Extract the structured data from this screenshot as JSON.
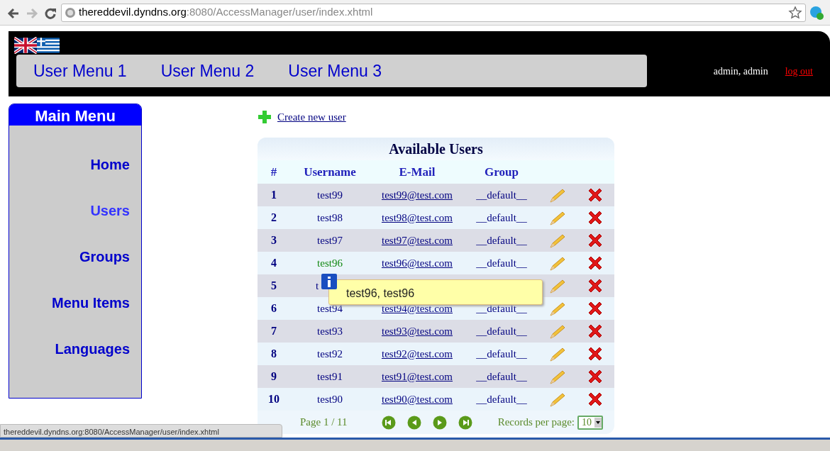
{
  "browser": {
    "url_host": "thereddevil.dyndns.org",
    "url_path": ":8080/AccessManager/user/index.xhtml"
  },
  "header": {
    "user_menu": [
      {
        "label": "User Menu 1"
      },
      {
        "label": "User Menu 2"
      },
      {
        "label": "User Menu 3"
      }
    ],
    "user": "admin, admin",
    "logout": "log out"
  },
  "main_menu": {
    "title": "Main Menu",
    "items": [
      {
        "label": "Home",
        "selected": false
      },
      {
        "label": "Users",
        "selected": true
      },
      {
        "label": "Groups",
        "selected": false
      },
      {
        "label": "Menu Items",
        "selected": false
      },
      {
        "label": "Languages",
        "selected": false
      }
    ]
  },
  "create_link": "Create new user",
  "table": {
    "title": "Available Users",
    "columns": [
      "#",
      "Username",
      "E-Mail",
      "Group"
    ],
    "rows": [
      {
        "num": "1",
        "username": "test99",
        "email": "test99@test.com",
        "group": "__default__",
        "hovered": false
      },
      {
        "num": "2",
        "username": "test98",
        "email": "test98@test.com",
        "group": "__default__",
        "hovered": false
      },
      {
        "num": "3",
        "username": "test97",
        "email": "test97@test.com",
        "group": "__default__",
        "hovered": false
      },
      {
        "num": "4",
        "username": "test96",
        "email": "test96@test.com",
        "group": "__default__",
        "hovered": true
      },
      {
        "num": "5",
        "username": "t",
        "hovered": false
      },
      {
        "num": "6",
        "username": "test94",
        "email": "test94@test.com",
        "group": "__default__",
        "hovered": false
      },
      {
        "num": "7",
        "username": "test93",
        "email": "test93@test.com",
        "group": "__default__",
        "hovered": false
      },
      {
        "num": "8",
        "username": "test92",
        "email": "test92@test.com",
        "group": "__default__",
        "hovered": false
      },
      {
        "num": "9",
        "username": "test91",
        "email": "test91@test.com",
        "group": "__default__",
        "hovered": false
      },
      {
        "num": "10",
        "username": "test90",
        "email": "test90@test.com",
        "group": "__default__",
        "hovered": false
      }
    ],
    "page": "Page 1 / 11",
    "records_label": "Records per page:",
    "records_value": "10"
  },
  "tooltip": "test96, test96",
  "status_bar": "thereddevil.dyndns.org:8080/AccessManager/user/index.xhtml"
}
